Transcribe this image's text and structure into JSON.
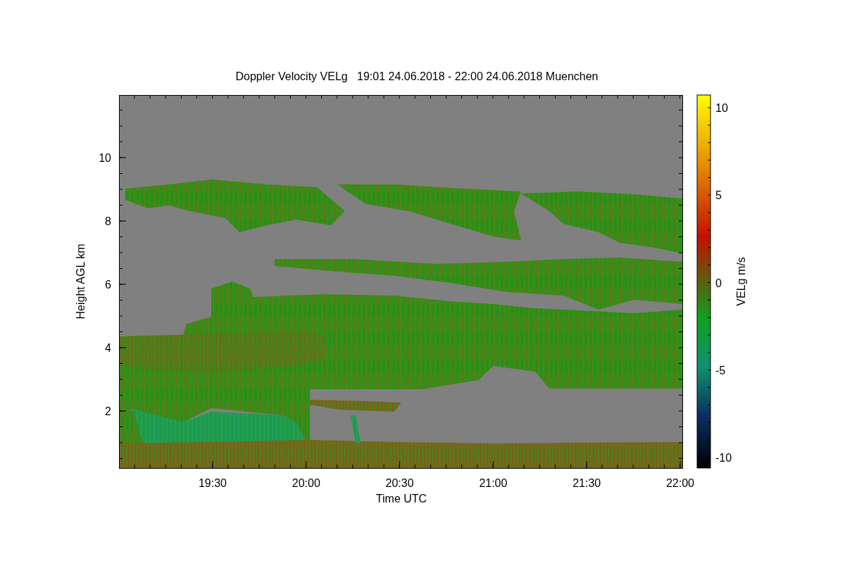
{
  "title": "Doppler Velocity VELg   19:01 24.06.2018 - 22:00 24.06.2018 Muenchen",
  "y_axis": {
    "label": "Height AGL km",
    "ticks": [
      "10",
      "8",
      "6",
      "4",
      "2"
    ]
  },
  "x_axis": {
    "label": "Time UTC",
    "ticks": [
      "19:30",
      "20:00",
      "20:30",
      "21:00",
      "21:30",
      "22:00"
    ]
  },
  "colorbar": {
    "label": "VELg m/s",
    "ticks": [
      "10",
      "5",
      "0",
      "-5",
      "-10"
    ]
  }
}
